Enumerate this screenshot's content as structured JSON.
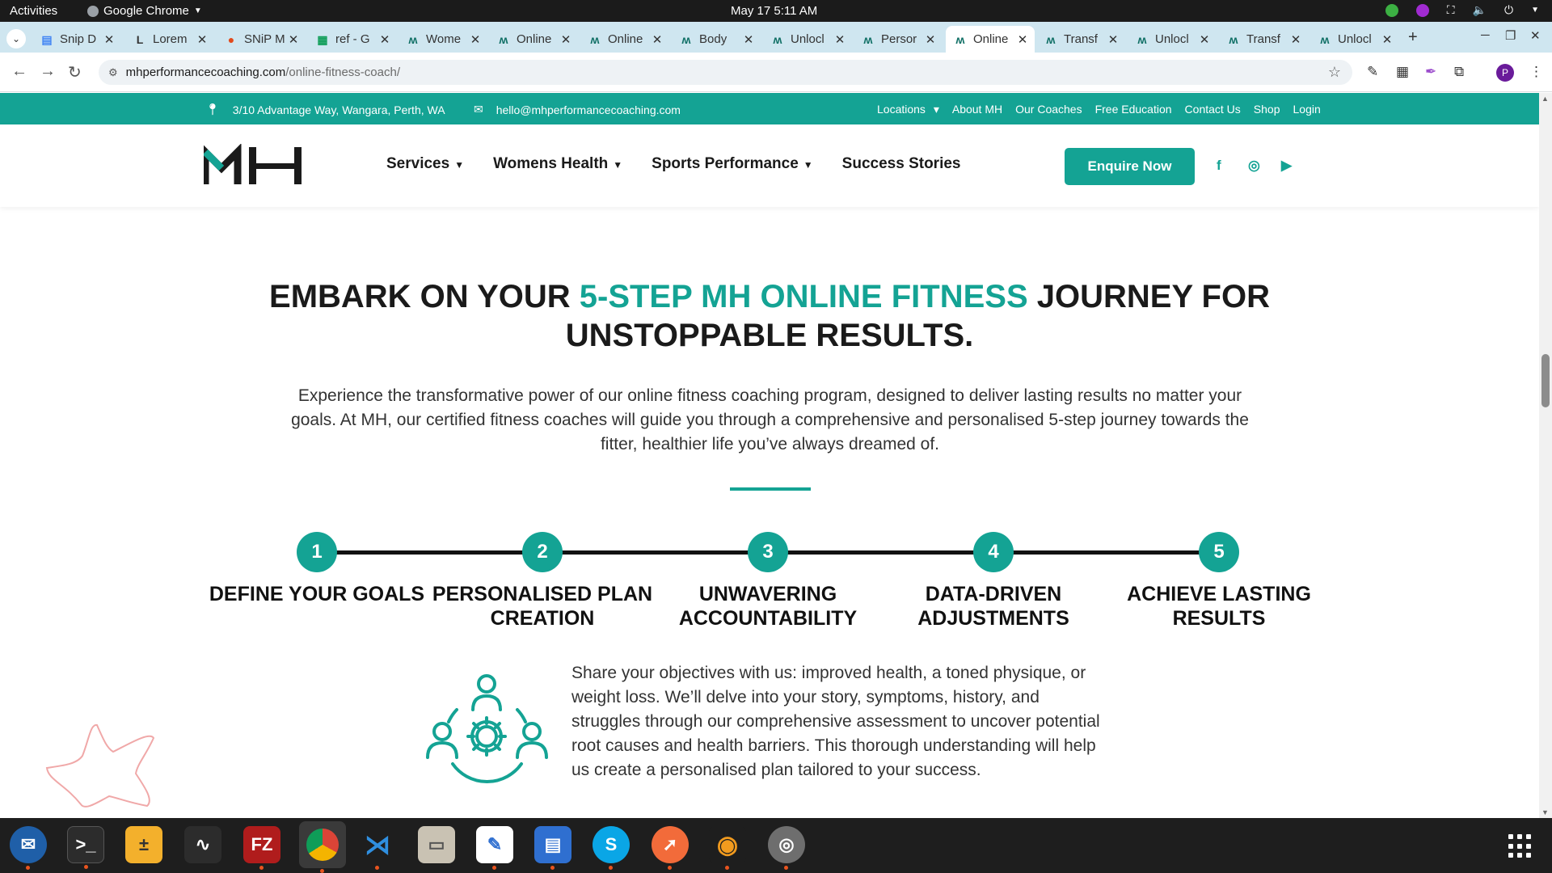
{
  "system": {
    "activities": "Activities",
    "app_name": "Google Chrome",
    "clock": "May 17  5:11 AM"
  },
  "tabs": [
    {
      "title": "Snip D",
      "icon": "docs-icon"
    },
    {
      "title": "Lorem",
      "icon": "lorem-icon"
    },
    {
      "title": "SNiP M",
      "icon": "snip-icon"
    },
    {
      "title": "ref - G",
      "icon": "sheets-icon"
    },
    {
      "title": "Wome",
      "icon": "mh-icon"
    },
    {
      "title": "Online",
      "icon": "mh-icon"
    },
    {
      "title": "Online",
      "icon": "mh-icon"
    },
    {
      "title": "Body",
      "icon": "mh-icon"
    },
    {
      "title": "Unlocl",
      "icon": "mh-icon"
    },
    {
      "title": "Persor",
      "icon": "mh-icon"
    },
    {
      "title": "Online",
      "icon": "mh-icon",
      "active": true
    },
    {
      "title": "Transf",
      "icon": "mh-icon"
    },
    {
      "title": "Unlocl",
      "icon": "mh-icon"
    },
    {
      "title": "Transf",
      "icon": "mh-icon"
    },
    {
      "title": "Unlocl",
      "icon": "mh-icon"
    }
  ],
  "address": {
    "host": "mhperformancecoaching.com",
    "path": "/online-fitness-coach/"
  },
  "profile_initial": "P",
  "site": {
    "address": "3/10 Advantage Way, Wangara, Perth, WA",
    "email": "hello@mhperformancecoaching.com",
    "top_links": [
      "Locations",
      "About MH",
      "Our Coaches",
      "Free Education",
      "Contact Us",
      "Shop",
      "Login"
    ],
    "nav": [
      "Services",
      "Womens Health",
      "Sports Performance",
      "Success Stories"
    ],
    "enquire": "Enquire Now",
    "brand_color": "#14a394"
  },
  "hero": {
    "title_part1": "EMBARK ON YOUR ",
    "title_accent": "5-STEP MH ONLINE FITNESS",
    "title_part2": " JOURNEY FOR UNSTOPPABLE RESULTS.",
    "intro": "Experience the transformative power of our online fitness coaching program, designed to deliver lasting results no matter your goals. At MH, our certified fitness coaches will guide you through a comprehensive and personalised 5-step journey towards the fitter, healthier life you’ve always dreamed of."
  },
  "steps": [
    {
      "num": "1",
      "label": "DEFINE YOUR GOALS"
    },
    {
      "num": "2",
      "label": "PERSONALISED PLAN CREATION"
    },
    {
      "num": "3",
      "label": "UNWAVERING ACCOUNTABILITY"
    },
    {
      "num": "4",
      "label": "DATA-DRIVEN ADJUSTMENTS"
    },
    {
      "num": "5",
      "label": "ACHIEVE LASTING RESULTS"
    }
  ],
  "detail": {
    "text": "Share your objectives with us: improved health, a toned physique, or weight loss. We’ll delve into your story, symptoms, history, and struggles through our comprehensive assessment to uncover potential root causes and health barriers. This thorough understanding will help us create a personalised plan tailored to your success."
  }
}
